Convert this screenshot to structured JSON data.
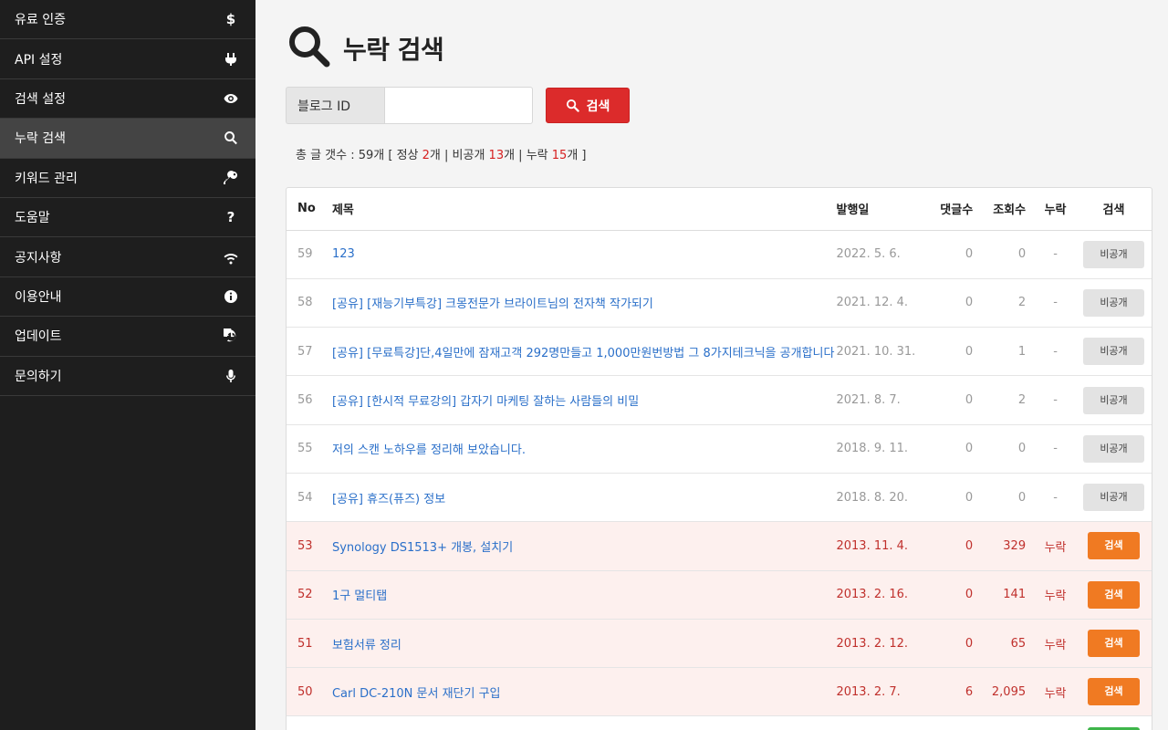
{
  "sidebar": {
    "items": [
      {
        "label": "유료 인증",
        "icon": "dollar-icon"
      },
      {
        "label": "API 설정",
        "icon": "plug-icon"
      },
      {
        "label": "검색 설정",
        "icon": "eye-icon"
      },
      {
        "label": "누락 검색",
        "icon": "search-icon",
        "active": true
      },
      {
        "label": "키워드 관리",
        "icon": "key-icon"
      },
      {
        "label": "도움말",
        "icon": "question-icon"
      },
      {
        "label": "공지사항",
        "icon": "wifi-icon"
      },
      {
        "label": "이용안내",
        "icon": "info-icon"
      },
      {
        "label": "업데이트",
        "icon": "history-icon"
      },
      {
        "label": "문의하기",
        "icon": "microphone-icon"
      }
    ]
  },
  "page": {
    "title": "누락 검색",
    "search_label": "블로그 ID",
    "search_value": "",
    "search_button": "검색"
  },
  "summary": {
    "prefix": "총 글 갯수 : 59개 [ 정상 ",
    "normal": "2",
    "mid1": "개 | 비공개 ",
    "private": "13",
    "mid2": "개 | 누락 ",
    "missing": "15",
    "suffix": "개 ]"
  },
  "table": {
    "headers": {
      "no": "No",
      "title": "제목",
      "date": "발행일",
      "comments": "댓글수",
      "views": "조회수",
      "missing": "누락",
      "action": "검색"
    },
    "rows": [
      {
        "no": "59",
        "title": "123",
        "date": "2022. 5. 6.",
        "comments": "0",
        "views": "0",
        "missing": "-",
        "action": "비공개",
        "state": "private"
      },
      {
        "no": "58",
        "title": "[공유] [재능기부특강] 크몽전문가 브라이트님의 전자책 작가되기",
        "date": "2021. 12. 4.",
        "comments": "0",
        "views": "2",
        "missing": "-",
        "action": "비공개",
        "state": "private"
      },
      {
        "no": "57",
        "title": "[공유] [무료특강]단,4일만에 잠재고객 292명만들고 1,000만원번방법 그 8가지테크닉을 공개합니다",
        "date": "2021. 10. 31.",
        "comments": "0",
        "views": "1",
        "missing": "-",
        "action": "비공개",
        "state": "private"
      },
      {
        "no": "56",
        "title": "[공유] [한시적 무료강의] 갑자기 마케팅 잘하는 사람들의 비밀",
        "date": "2021. 8. 7.",
        "comments": "0",
        "views": "2",
        "missing": "-",
        "action": "비공개",
        "state": "private"
      },
      {
        "no": "55",
        "title": "저의 스캔 노하우를 정리해 보았습니다.",
        "date": "2018. 9. 11.",
        "comments": "0",
        "views": "0",
        "missing": "-",
        "action": "비공개",
        "state": "private"
      },
      {
        "no": "54",
        "title": "[공유] 휴즈(퓨즈) 정보",
        "date": "2018. 8. 20.",
        "comments": "0",
        "views": "0",
        "missing": "-",
        "action": "비공개",
        "state": "private"
      },
      {
        "no": "53",
        "title": "Synology DS1513+ 개봉, 설치기",
        "date": "2013. 11. 4.",
        "comments": "0",
        "views": "329",
        "missing": "누락",
        "action": "검색",
        "state": "missing"
      },
      {
        "no": "52",
        "title": "1구 멀티탭",
        "date": "2013. 2. 16.",
        "comments": "0",
        "views": "141",
        "missing": "누락",
        "action": "검색",
        "state": "missing"
      },
      {
        "no": "51",
        "title": "보험서류 정리",
        "date": "2013. 2. 12.",
        "comments": "0",
        "views": "65",
        "missing": "누락",
        "action": "검색",
        "state": "missing"
      },
      {
        "no": "50",
        "title": "Carl DC-210N 문서 재단기 구입",
        "date": "2013. 2. 7.",
        "comments": "6",
        "views": "2,095",
        "missing": "누락",
        "action": "검색",
        "state": "missing"
      }
    ]
  },
  "colors": {
    "accent_red": "#dc2b2b",
    "orange": "#f07a22",
    "sidebar_bg": "#1e1e1e",
    "link_blue": "#2a6fc9"
  }
}
